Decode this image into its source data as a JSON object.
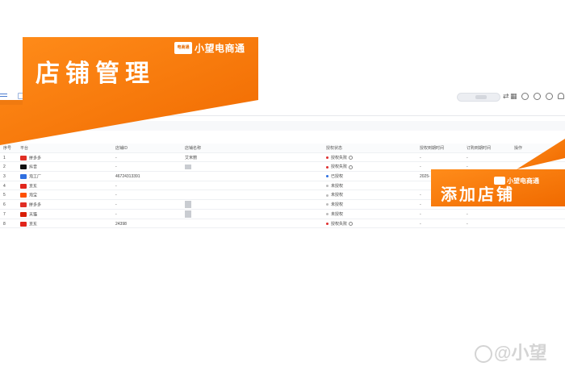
{
  "banner": {
    "brand_logo_text": "电商通",
    "brand_name": "小望电商通",
    "title": "店铺管理",
    "add_title": "添加店铺",
    "add_brand_name": "小望电商通"
  },
  "toolbar": {
    "left_icon": "menu-icon",
    "right_icons": [
      "swap-icon",
      "grid-icon",
      "headset-icon",
      "help-icon",
      "info-icon",
      "bell-icon",
      "user-icon"
    ]
  },
  "table": {
    "headers": {
      "no": "序号",
      "platform": "平台",
      "shop_id": "店铺ID",
      "shop_name": "店铺名称",
      "status": "授权状态",
      "expire": "授权到期时间",
      "order_expire": "订购到期时间",
      "ops": "操作"
    },
    "rows": [
      {
        "no": "1",
        "platform": "拼多多",
        "logo_color": "#e02e24",
        "shop_id": "-",
        "shop_name": "艾米丽",
        "status": "授权失败",
        "status_color": "#e03030",
        "has_info": true,
        "expire": "-",
        "order_expire": "-"
      },
      {
        "no": "2",
        "platform": "抖音",
        "logo_color": "#111111",
        "shop_id": "-",
        "shop_name": "",
        "status": "授权失败",
        "status_color": "#e03030",
        "has_info": true,
        "expire": "-",
        "order_expire": "-"
      },
      {
        "no": "3",
        "platform": "淘工厂",
        "logo_color": "#2f6fe0",
        "shop_id": "46724313391",
        "shop_name": "",
        "status": "已授权",
        "status_color": "#2f6fe0",
        "has_info": false,
        "expire": "2025-",
        "order_expire": ""
      },
      {
        "no": "4",
        "platform": "京东",
        "logo_color": "#e1251b",
        "shop_id": "-",
        "shop_name": "",
        "status": "未授权",
        "status_color": "#bbbbbb",
        "has_info": false,
        "expire": "",
        "order_expire": ""
      },
      {
        "no": "5",
        "platform": "淘宝",
        "logo_color": "#ff5000",
        "shop_id": "-",
        "shop_name": "",
        "status": "未授权",
        "status_color": "#bbbbbb",
        "has_info": false,
        "expire": "-",
        "order_expire": "-"
      },
      {
        "no": "6",
        "platform": "拼多多",
        "logo_color": "#e02e24",
        "shop_id": "-",
        "shop_name": "",
        "status": "未授权",
        "status_color": "#bbbbbb",
        "has_info": false,
        "expire": "-",
        "order_expire": "-"
      },
      {
        "no": "7",
        "platform": "天猫",
        "logo_color": "#d81e06",
        "shop_id": "-",
        "shop_name": "",
        "status": "未授权",
        "status_color": "#bbbbbb",
        "has_info": false,
        "expire": "-",
        "order_expire": "-"
      },
      {
        "no": "8",
        "platform": "京东",
        "logo_color": "#e1251b",
        "shop_id": "24398",
        "shop_name": "",
        "status": "授权失败",
        "status_color": "#e03030",
        "has_info": true,
        "expire": "-",
        "order_expire": "-"
      }
    ]
  },
  "colors": {
    "accent_orange": "#ff7a00",
    "link_blue": "#5b8fe0"
  },
  "watermark": "@小望"
}
